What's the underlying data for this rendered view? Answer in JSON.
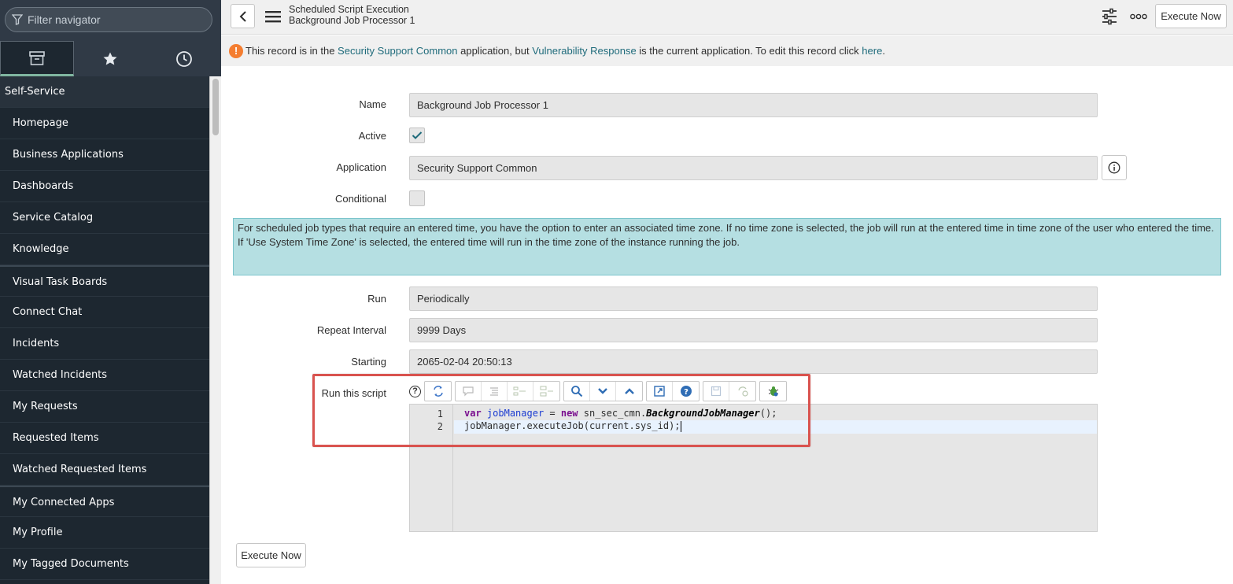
{
  "nav": {
    "filter_placeholder": "Filter navigator",
    "tabs": [
      {
        "icon": "archive-icon"
      },
      {
        "icon": "star-icon"
      },
      {
        "icon": "clock-icon"
      }
    ],
    "section": "Self-Service",
    "items": [
      "Homepage",
      "Business Applications",
      "Dashboards",
      "Service Catalog",
      "Knowledge",
      "Visual Task Boards",
      "Connect Chat",
      "Incidents",
      "Watched Incidents",
      "My Requests",
      "Requested Items",
      "Watched Requested Items",
      "My Connected Apps",
      "My Profile",
      "My Tagged Documents"
    ]
  },
  "header": {
    "title": "Scheduled Script Execution",
    "subtitle": "Background Job Processor 1",
    "execute_label": "Execute Now"
  },
  "banner": {
    "prefix": "This record is in the ",
    "app_link": "Security Support Common",
    "middle1": " application, but ",
    "current_link": "Vulnerability Response",
    "middle2": " is the current application. To edit this record click ",
    "here_link": "here",
    "suffix": "."
  },
  "form": {
    "name_label": "Name",
    "name_value": "Background Job Processor 1",
    "active_label": "Active",
    "active_checked": true,
    "application_label": "Application",
    "application_value": "Security Support Common",
    "conditional_label": "Conditional",
    "conditional_checked": false,
    "notice": "For scheduled job types that require an entered time, you have the option to enter an associated time zone. If no time zone is selected, the job will run at the entered time in time zone of the user who entered the time. If 'Use System Time Zone' is selected, the entered time will run in the time zone of the instance running the job.",
    "run_label": "Run",
    "run_value": "Periodically",
    "repeat_label": "Repeat Interval",
    "repeat_value": "9999 Days",
    "starting_label": "Starting",
    "starting_value": "2065-02-04 20:50:13",
    "script_label": "Run this script",
    "script_help": "?",
    "script_lines": [
      {
        "num": "1",
        "var_kw": "var",
        "var_name": "jobManager",
        "eq": " = ",
        "new_kw": "new",
        "ns": " sn_sec_cmn.",
        "cls": "BackgroundJobManager",
        "end": "();"
      },
      {
        "num": "2",
        "text": "jobManager.executeJob(current.sys_id);"
      }
    ],
    "execute_label": "Execute Now"
  },
  "colors": {
    "nav_bg": "#1d2730",
    "accent": "#80b6a1",
    "warning": "#f47d30",
    "notice_bg": "#b5dfe2",
    "highlight": "#d9534f"
  }
}
